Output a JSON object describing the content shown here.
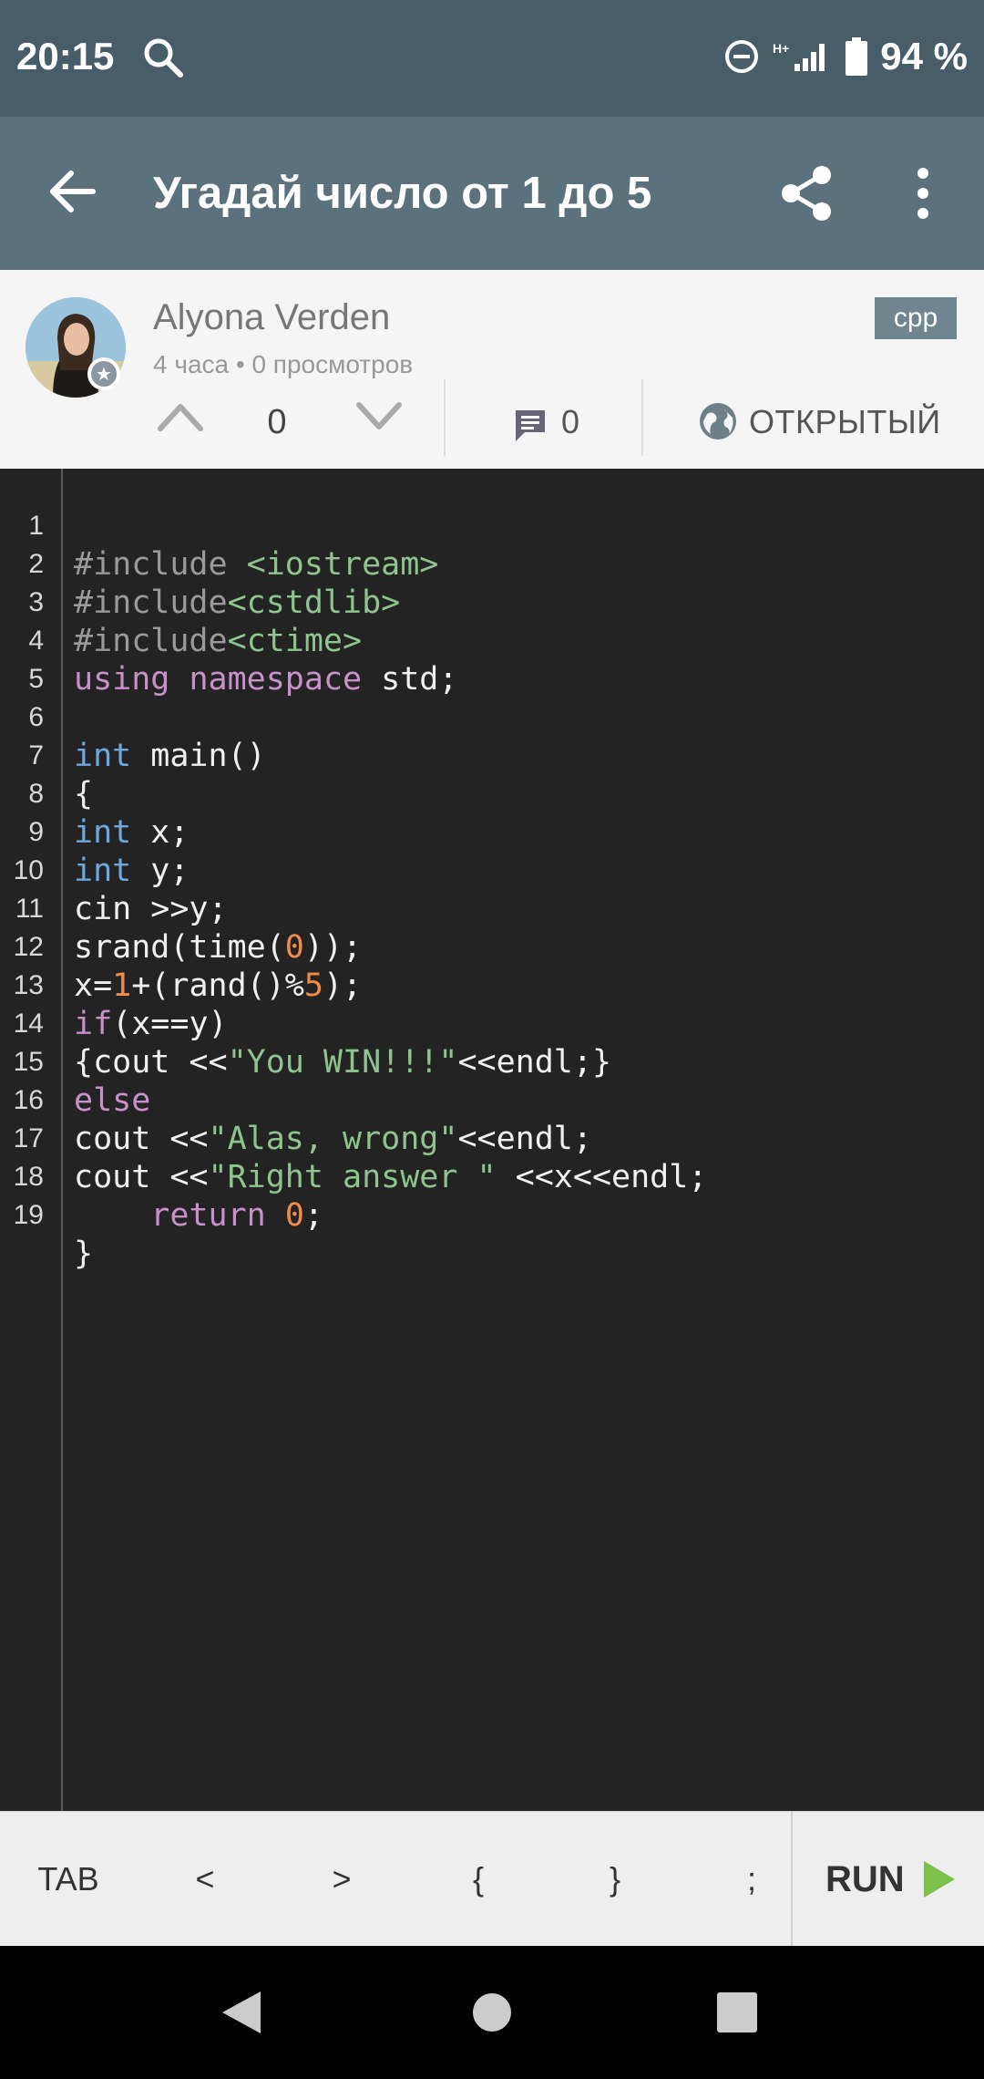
{
  "status": {
    "time": "20:15",
    "battery": "94 %"
  },
  "appbar": {
    "title": "Угадай число от 1 до 5"
  },
  "post": {
    "author": "Alyona Verden",
    "meta": "4 часа • 0 просмотров",
    "lang": "cpp",
    "votes": "0",
    "comments": "0",
    "privacy": "ОТКРЫТЫЙ"
  },
  "code": {
    "lines": [
      {
        "n": "1"
      },
      {
        "n": "2"
      },
      {
        "n": "3"
      },
      {
        "n": "4"
      },
      {
        "n": "5"
      },
      {
        "n": "6"
      },
      {
        "n": "7"
      },
      {
        "n": "8"
      },
      {
        "n": "9"
      },
      {
        "n": "10"
      },
      {
        "n": "11"
      },
      {
        "n": "12"
      },
      {
        "n": "13"
      },
      {
        "n": "14"
      },
      {
        "n": "15"
      },
      {
        "n": "16"
      },
      {
        "n": "17"
      },
      {
        "n": "18"
      },
      {
        "n": "19"
      }
    ],
    "tokens": {
      "l1a": "#include ",
      "l1b": "<iostream>",
      "l2a": "#include",
      "l2b": "<cstdlib>",
      "l3a": "#include",
      "l3b": "<ctime>",
      "l4a": "using",
      "l4b": " ",
      "l4c": "namespace",
      "l4d": " std;",
      "l6a": "int",
      "l6b": " main()",
      "l7": "{",
      "l8a": "int",
      "l8b": " x;",
      "l9a": "int",
      "l9b": " y;",
      "l10": "cin >>y;",
      "l11a": "srand(time(",
      "l11b": "0",
      "l11c": "));",
      "l12a": "x=",
      "l12b": "1",
      "l12c": "+(rand()%",
      "l12d": "5",
      "l12e": ");",
      "l13a": "if",
      "l13b": "(x==y)",
      "l14a": "{cout <<",
      "l14b": "\"You WIN!!!\"",
      "l14c": "<<endl;}",
      "l15": "else",
      "l16a": "cout <<",
      "l16b": "\"Alas, wrong\"",
      "l16c": "<<endl;",
      "l17a": "cout <<",
      "l17b": "\"Right answer \"",
      "l17c": " <<x<<endl;",
      "l18a": "    ",
      "l18b": "return",
      "l18c": " ",
      "l18d": "0",
      "l18e": ";",
      "l19": "}"
    }
  },
  "toolbar": {
    "keys": [
      "TAB",
      "<",
      ">",
      "{",
      "}",
      ";"
    ],
    "run": "RUN"
  },
  "colors": {
    "statusbar": "#475e69",
    "appbar": "#5b727d",
    "editor_bg": "#232323",
    "run_accent": "#7cc24a"
  }
}
